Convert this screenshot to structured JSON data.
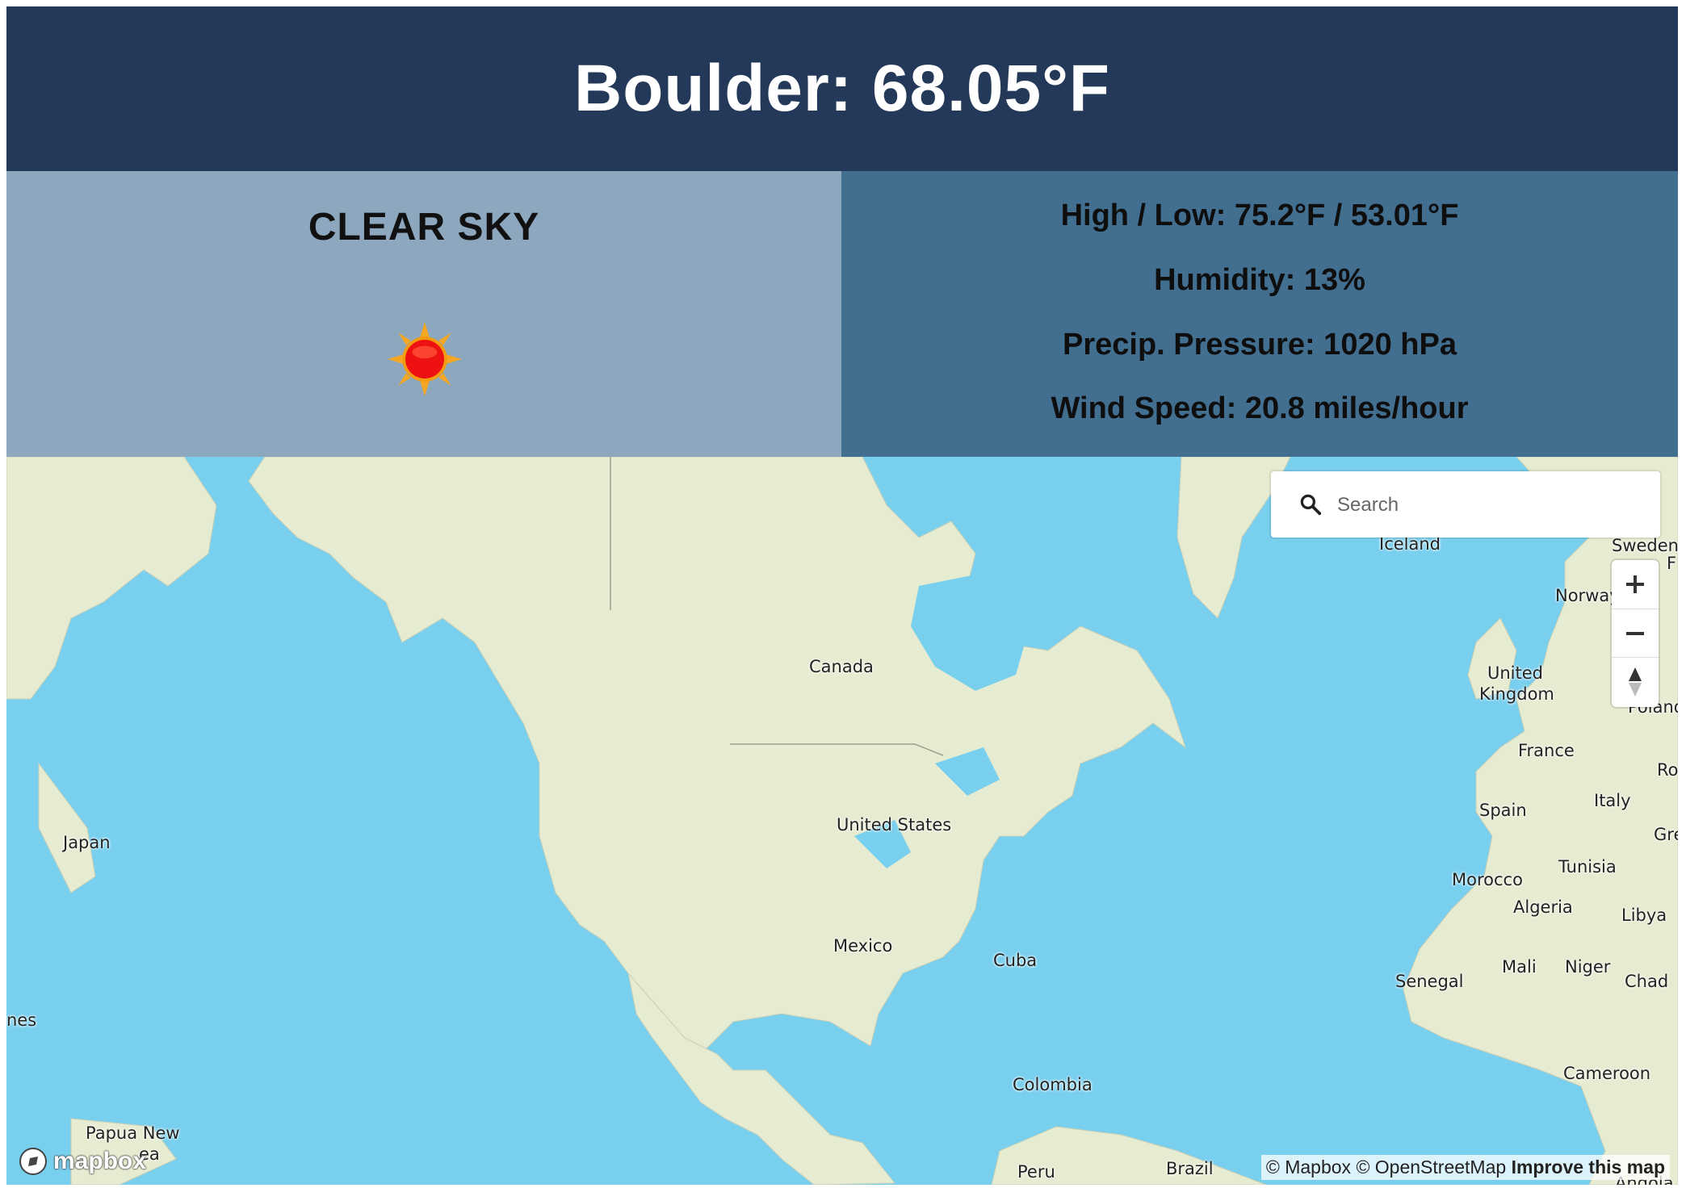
{
  "header": {
    "title": "Boulder: 68.05°F"
  },
  "weather": {
    "condition": "CLEAR SKY",
    "icon": "sun-icon",
    "high_low": "High / Low: 75.2°F / 53.01°F",
    "humidity": "Humidity: 13%",
    "pressure": "Precip. Pressure: 1020 hPa",
    "wind": "Wind Speed: 20.8 miles/hour"
  },
  "map": {
    "search_placeholder": "Search",
    "zoom_in_icon": "plus-icon",
    "zoom_out_icon": "minus-icon",
    "compass_icon": "compass-icon",
    "labels": {
      "canada": "Canada",
      "united_states": "United States",
      "mexico": "Mexico",
      "cuba": "Cuba",
      "colombia": "Colombia",
      "peru": "Peru",
      "brazil": "Brazil",
      "japan": "Japan",
      "papua_new": "Papua New",
      "papua_guinea_fragment": "ea",
      "philippines_fragment": "nes",
      "iceland": "Iceland",
      "sweden": "Sweden",
      "finland_fragment": "F",
      "norway": "Norway",
      "united": "United",
      "kingdom": "Kingdom",
      "poland": "Poland",
      "france": "France",
      "romania_fragment": "Ro",
      "italy": "Italy",
      "spain": "Spain",
      "greece_fragment": "Gre",
      "tunisia": "Tunisia",
      "morocco": "Morocco",
      "algeria": "Algeria",
      "libya": "Libya",
      "senegal": "Senegal",
      "mali": "Mali",
      "niger": "Niger",
      "chad": "Chad",
      "cameroon": "Cameroon",
      "angola": "Angola"
    },
    "attribution": {
      "mapbox": "© Mapbox",
      "osm": "© OpenStreetMap",
      "improve": "Improve this map"
    },
    "logo_text": "mapbox"
  },
  "colors": {
    "header_bg": "#243859",
    "left_panel_bg": "#8da7bf",
    "right_panel_bg": "#426e90",
    "water": "#79cfee",
    "land": "#e6ecd1"
  }
}
